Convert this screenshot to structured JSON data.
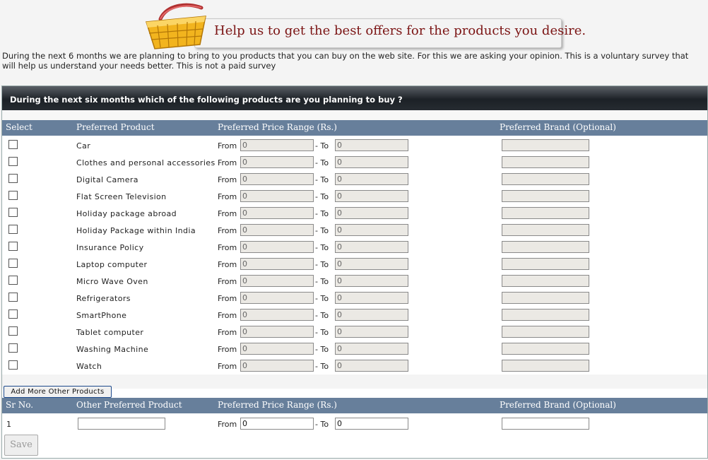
{
  "banner": {
    "title": "Help us to get the best offers for the products you desire."
  },
  "intro": "During the next 6 months we are planning to bring to you products that you can buy on the web site. For this we are asking your opinion. This is a voluntary survey that will help us understand your needs better. This is not a paid survey",
  "panel": {
    "heading": "During the next six months which of the following products are you planning to buy ?",
    "columns": {
      "select": "Select",
      "product": "Preferred Product",
      "price": "Preferred Price Range (Rs.)",
      "brand": "Preferred Brand (Optional)"
    },
    "from_label": "From",
    "to_label": "- To",
    "default_value": "0",
    "products": [
      "Car",
      "Clothes and personal accessories",
      "Digital Camera",
      "Flat Screen Television",
      "Holiday package abroad",
      "Holiday Package within India",
      "Insurance Policy",
      "Laptop computer",
      "Micro Wave Oven",
      "Refrigerators",
      "SmartPhone",
      "Tablet computer",
      "Washing Machine",
      "Watch"
    ],
    "add_more_label": "Add More Other Products",
    "other_columns": {
      "sr": "Sr No.",
      "product": "Other Preferred Product",
      "price": "Preferred Price Range (Rs.)",
      "brand": "Preferred Brand (Optional)"
    },
    "other_rows": [
      {
        "sr": "1",
        "product": "",
        "from": "0",
        "to": "0",
        "brand": ""
      }
    ],
    "save_label": "Save"
  },
  "colors": {
    "header_bar": "#677f9b",
    "title_red": "#7b1414",
    "panel_head": "#1c2126"
  }
}
